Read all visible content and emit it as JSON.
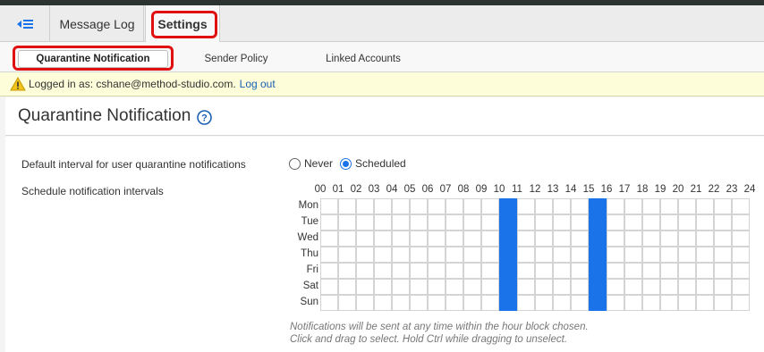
{
  "tabs": {
    "back_icon": "collapse-menu-icon",
    "message_log": "Message Log",
    "settings": "Settings"
  },
  "subtabs": {
    "quarantine": "Quarantine Notification",
    "sender_policy": "Sender Policy",
    "linked_accounts": "Linked Accounts"
  },
  "login": {
    "prefix": "Logged in as: cshane@method-studio.com.",
    "logout": "Log out"
  },
  "page": {
    "title": "Quarantine Notification",
    "help_icon": "help-icon"
  },
  "form": {
    "default_label": "Default interval for user quarantine notifications",
    "schedule_label": "Schedule notification intervals",
    "radio_never": "Never",
    "radio_scheduled": "Scheduled",
    "selected": "Scheduled"
  },
  "schedule": {
    "hours": [
      "00",
      "01",
      "02",
      "03",
      "04",
      "05",
      "06",
      "07",
      "08",
      "09",
      "10",
      "11",
      "12",
      "13",
      "14",
      "15",
      "16",
      "17",
      "18",
      "19",
      "20",
      "21",
      "22",
      "23",
      "24"
    ],
    "days": [
      "Mon",
      "Tue",
      "Wed",
      "Thu",
      "Fri",
      "Sat",
      "Sun"
    ],
    "selected_hours": [
      10,
      15
    ]
  },
  "note": {
    "line1": "Notifications will be sent at any time within the hour block chosen.",
    "line2": "Click and drag to select. Hold Ctrl while dragging to unselect."
  },
  "colors": {
    "accent": "#1a73e8",
    "highlight_ring": "#e01010",
    "login_bar": "#fdfdd9"
  }
}
